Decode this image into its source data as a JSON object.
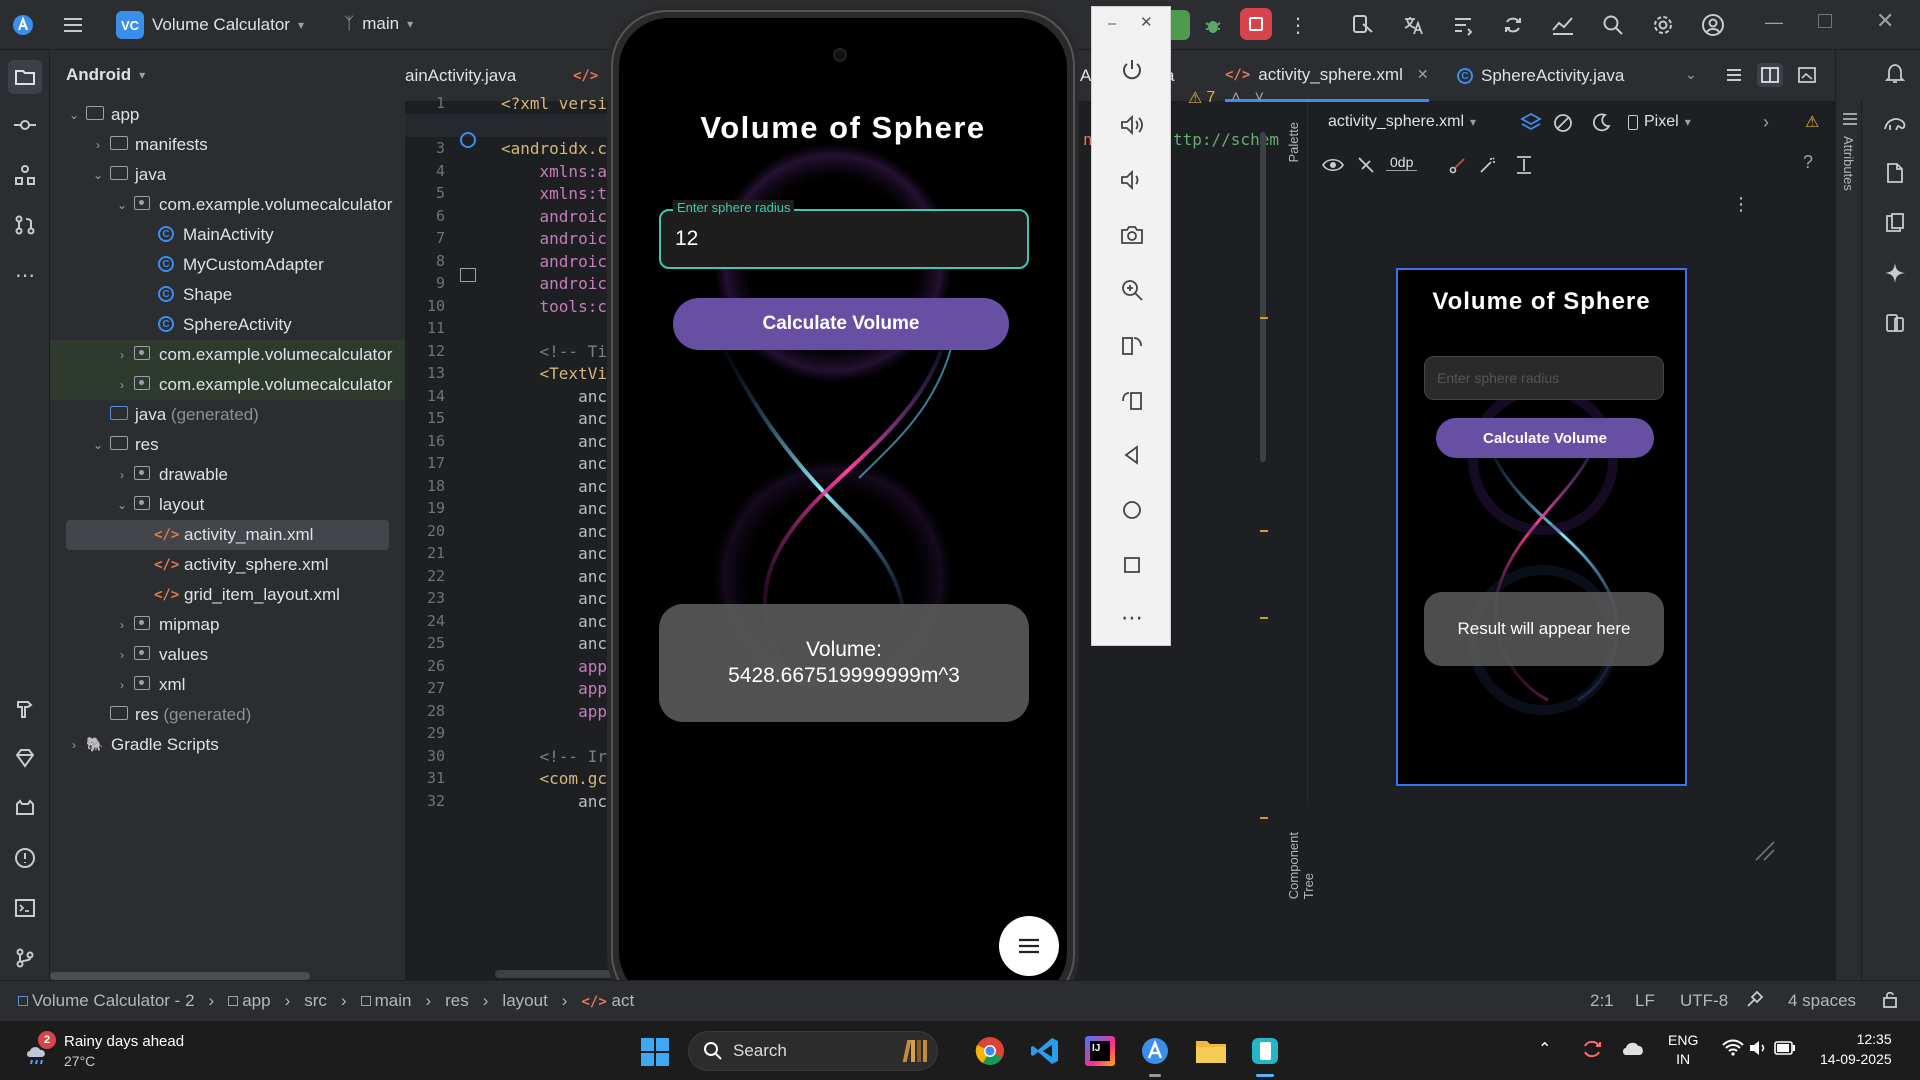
{
  "titlebar": {
    "project_badge": "VC",
    "project_name": "Volume Calculator",
    "branch": "main"
  },
  "project_panel": {
    "view_selector": "Android",
    "tree": [
      {
        "label": "app",
        "type": "module"
      },
      {
        "label": "manifests",
        "type": "folder"
      },
      {
        "label": "java",
        "type": "folder"
      },
      {
        "label": "com.example.volumecalculator",
        "type": "package"
      },
      {
        "label": "MainActivity",
        "type": "class"
      },
      {
        "label": "MyCustomAdapter",
        "type": "class"
      },
      {
        "label": "Shape",
        "type": "class"
      },
      {
        "label": "SphereActivity",
        "type": "class"
      },
      {
        "label": "com.example.volumecalculator",
        "type": "package"
      },
      {
        "label": "com.example.volumecalculator",
        "type": "package"
      },
      {
        "label": "java",
        "suffix": "(generated)",
        "type": "folder"
      },
      {
        "label": "res",
        "type": "folder"
      },
      {
        "label": "drawable",
        "type": "folder"
      },
      {
        "label": "layout",
        "type": "folder"
      },
      {
        "label": "activity_main.xml",
        "type": "xml"
      },
      {
        "label": "activity_sphere.xml",
        "type": "xml"
      },
      {
        "label": "grid_item_layout.xml",
        "type": "xml"
      },
      {
        "label": "mipmap",
        "type": "folder"
      },
      {
        "label": "values",
        "type": "folder"
      },
      {
        "label": "xml",
        "type": "folder"
      },
      {
        "label": "res",
        "suffix": "(generated)",
        "type": "folder"
      },
      {
        "label": "Gradle Scripts",
        "type": "gradle"
      }
    ]
  },
  "tabs": {
    "tab1": "ainActivity.java",
    "tab2": "g",
    "tab_partial": "A",
    "tab_partial2": "a",
    "tab_active": "activity_sphere.xml",
    "tab_next": "SphereActivity.java"
  },
  "editor": {
    "line_numbers": [
      "1",
      "2",
      "3",
      "4",
      "5",
      "6",
      "7",
      "8",
      "9",
      "10",
      "11",
      "12",
      "13",
      "14",
      "15",
      "16",
      "17",
      "18",
      "19",
      "20",
      "21",
      "22",
      "23",
      "24",
      "25",
      "26",
      "27",
      "28",
      "29",
      "30",
      "31",
      "32"
    ],
    "lines": [
      "<?xml versi",
      "",
      "<androidx.c",
      "    xmlns:a",
      "    xmlns:t",
      "    androic",
      "    androic",
      "    androic",
      "    androic",
      "    tools:c",
      "",
      "    <!-- Ti",
      "    <TextVi",
      "        anc",
      "        anc",
      "        anc",
      "        anc",
      "        anc",
      "        anc",
      "        anc",
      "        anc",
      "        anc",
      "        anc",
      "        anc",
      "        anc",
      "        app",
      "        app",
      "        app",
      "",
      "    <!-- Ir",
      "    <com.gc",
      "        anc"
    ],
    "right_fragment_1": "n",
    "right_fragment_2": "ttp://schem",
    "warning_count": "7"
  },
  "design": {
    "file_selector": "activity_sphere.xml",
    "device": "Pixel",
    "margin_value": "0dp",
    "palette_label": "Palette",
    "component_tree_label": "Component Tree",
    "attributes_label": "Attributes",
    "preview_title": "Volume of Sphere",
    "preview_placeholder": "Enter sphere radius",
    "preview_button": "Calculate Volume",
    "preview_result": "Result will appear here"
  },
  "phone": {
    "title": "Volume of Sphere",
    "input_label": "Enter sphere radius",
    "input_value": "12",
    "button": "Calculate Volume",
    "result_line1": "Volume:",
    "result_line2": "5428.667519999999m^3"
  },
  "statusbar": {
    "breadcrumb": [
      "Volume Calculator - 2",
      "app",
      "src",
      "main",
      "res",
      "layout",
      "act"
    ],
    "position": "2:1",
    "line_sep": "LF",
    "encoding": "UTF-8",
    "indent": "4 spaces"
  },
  "taskbar": {
    "weather_badge": "2",
    "weather_title": "Rainy days ahead",
    "weather_temp": "27°C",
    "search": "Search",
    "lang1": "ENG",
    "lang2": "IN",
    "time": "12:35",
    "date": "14-09-2025"
  }
}
